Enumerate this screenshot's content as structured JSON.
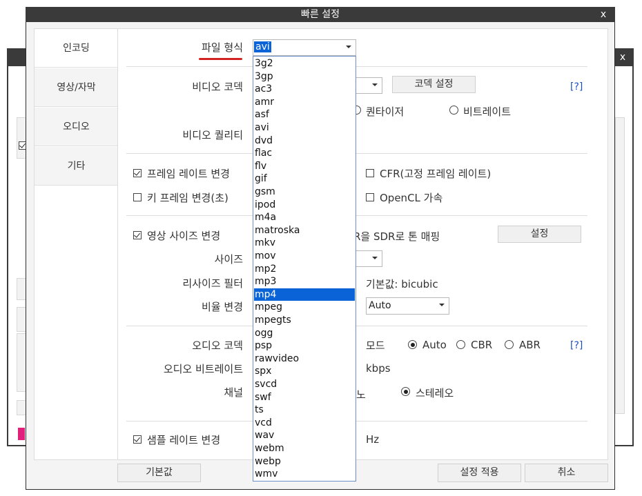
{
  "background_window": {
    "close_label": "x"
  },
  "dialog": {
    "title": "빠른 설정",
    "close_label": "x"
  },
  "nav": [
    "인코딩",
    "영상/자막",
    "오디오",
    "기타"
  ],
  "file_format": {
    "label": "파일 형식",
    "selected": "avi",
    "options": [
      "3g2",
      "3gp",
      "ac3",
      "amr",
      "asf",
      "avi",
      "dvd",
      "flac",
      "flv",
      "gif",
      "gsm",
      "ipod",
      "m4a",
      "matroska",
      "mkv",
      "mov",
      "mp2",
      "mp3",
      "mp4",
      "mpeg",
      "mpegts",
      "ogg",
      "psp",
      "rawvideo",
      "spx",
      "svcd",
      "swf",
      "ts",
      "vcd",
      "wav",
      "webm",
      "webp",
      "wmv"
    ],
    "highlighted": "mp4"
  },
  "video": {
    "codec_label": "비디오 코덱",
    "codec_settings_button": "코덱 설정",
    "help": "[?]",
    "quantizer_label": "퀀타이저",
    "bitrate_label": "비트레이트",
    "quality_label": "비디오 퀄리티"
  },
  "frame": {
    "change_fps_label": "프레임 레이트 변경",
    "cfr_label": "CFR(고정 프레임 레이트)",
    "keyframe_label": "키 프레임 변경(초)",
    "opencl_label": "OpenCL 가속"
  },
  "size": {
    "change_size_label": "영상 사이즈 변경",
    "tonemap_label": "R을 SDR로 톤 매핑",
    "settings_button": "설정",
    "size_label": "사이즈",
    "resize_filter_label": "리사이즈 필터",
    "resize_default": "기본값: bicubic",
    "ratio_label": "비율 변경",
    "ratio_value": "Auto"
  },
  "audio": {
    "codec_label": "오디오 코덱",
    "mode_label": "모드",
    "mode_options": [
      "Auto",
      "CBR",
      "ABR"
    ],
    "mode_selected": "Auto",
    "help": "[?]",
    "bitrate_label": "오디오 비트레이트",
    "bitrate_unit": "kbps",
    "channel_label": "채널",
    "channel_partial": "노",
    "stereo_label": "스테레오",
    "samplerate_label": "샘플 레이트 변경",
    "samplerate_unit": "Hz"
  },
  "footer": {
    "default_button": "기본값",
    "apply_button": "설정 적용",
    "cancel_button": "취소"
  },
  "colors": {
    "accent": "#0a64d8",
    "title_bar": "#3a3a3a",
    "underline": "#d32222",
    "help_link": "#1a4fc0"
  }
}
